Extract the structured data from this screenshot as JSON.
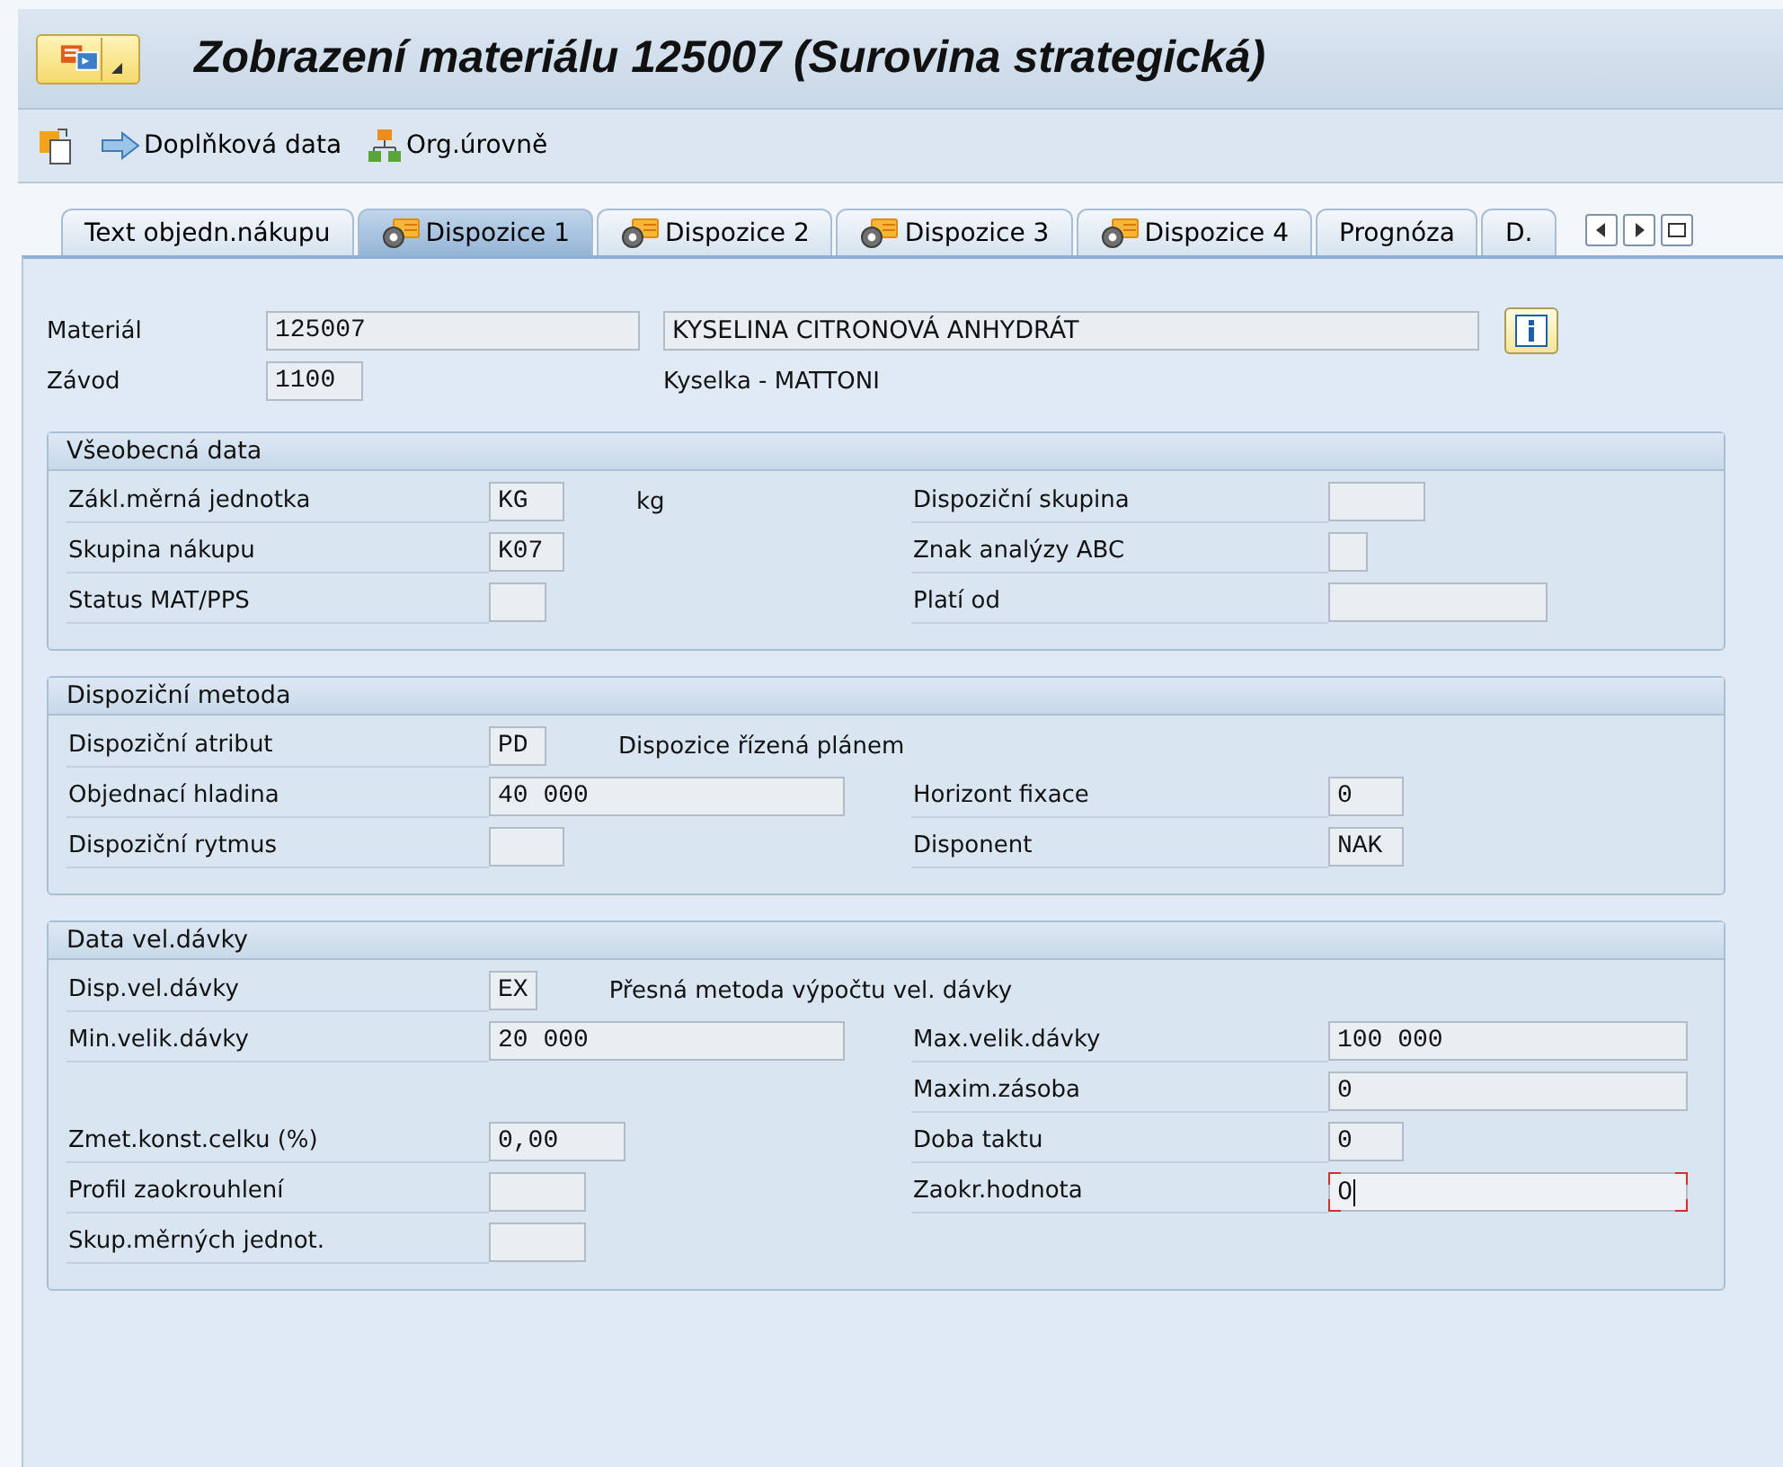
{
  "window": {
    "title": "Zobrazení materiálu 125007 (Surovina strategická)"
  },
  "toolbar": {
    "items": [
      {
        "kind": "icon"
      },
      {
        "kind": "arrow",
        "label": "Doplňková data"
      },
      {
        "kind": "org",
        "label": "Org.úrovně"
      }
    ]
  },
  "tabs": [
    {
      "label": "Text objedn.nákupu",
      "kind": "plain",
      "selected": false
    },
    {
      "label": "Dispozice 1",
      "kind": "mrp",
      "selected": true
    },
    {
      "label": "Dispozice 2",
      "kind": "mrp",
      "selected": false
    },
    {
      "label": "Dispozice 3",
      "kind": "mrp",
      "selected": false
    },
    {
      "label": "Dispozice 4",
      "kind": "mrp",
      "selected": false
    },
    {
      "label": "Prognóza",
      "kind": "plain",
      "selected": false
    },
    {
      "label": "D.",
      "kind": "plain",
      "selected": false
    }
  ],
  "header": {
    "material": {
      "label": "Materiál",
      "value": "125007",
      "description": "KYSELINA CITRONOVÁ ANHYDRÁT"
    },
    "plant": {
      "label": "Závod",
      "value": "1100",
      "description": "Kyselka - MATTONI"
    }
  },
  "sections": [
    {
      "title": "Všeobecná data",
      "rows": [
        {
          "left": {
            "label": "Zákl.měrná jednotka",
            "value": "KG",
            "focused": false,
            "text": "kg"
          },
          "right": {
            "label": "Dispoziční skupina",
            "focused": false
          }
        },
        {
          "left": {
            "label": "Skupina nákupu",
            "value": "K07",
            "focused": false
          },
          "right": {
            "label": "Znak analýzy ABC",
            "focused": false
          }
        },
        {
          "left": {
            "label": "Status MAT/PPS",
            "focused": false
          },
          "right": {
            "label": "Platí od",
            "focused": false
          }
        }
      ]
    },
    {
      "title": "Dispoziční metoda",
      "rows": [
        {
          "left": {
            "label": "Dispoziční atribut",
            "value": "PD",
            "focused": false,
            "text": "Dispozice řízená plánem"
          }
        },
        {
          "left": {
            "label": "Objednací hladina",
            "value": "40 000",
            "focused": false
          },
          "right": {
            "label": "Horizont fixace",
            "value": "0",
            "focused": false
          }
        },
        {
          "left": {
            "label": "Dispoziční rytmus",
            "focused": false
          },
          "right": {
            "label": "Disponent",
            "value": "NAK",
            "focused": false
          }
        }
      ]
    },
    {
      "title": "Data vel.dávky",
      "rows": [
        {
          "left": {
            "label": "Disp.vel.dávky",
            "value": "EX",
            "focused": false,
            "text": "Přesná metoda výpočtu vel. dávky"
          }
        },
        {
          "left": {
            "label": "Min.velik.dávky",
            "value": "20 000",
            "focused": false
          },
          "right": {
            "label": "Max.velik.dávky",
            "value": "100 000",
            "focused": false
          }
        },
        {
          "right": {
            "label": "Maxim.zásoba",
            "value": "0",
            "focused": false
          }
        },
        {
          "left": {
            "label": "Zmet.konst.celku (%)",
            "value": "0,00",
            "focused": false
          },
          "right": {
            "label": "Doba taktu",
            "value": "0",
            "focused": false
          }
        },
        {
          "left": {
            "label": "Profil zaokrouhlení",
            "focused": false
          },
          "right": {
            "label": "Zaokr.hodnota",
            "value": "0",
            "focused": true
          }
        },
        {
          "left": {
            "label": "Skup.měrných jednot.",
            "focused": false
          }
        }
      ]
    }
  ]
}
